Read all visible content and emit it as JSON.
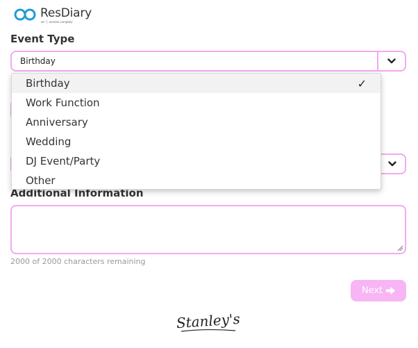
{
  "brand": {
    "name": "ResDiary",
    "tagline": "an ⓘ access company",
    "logo_icon": "infinity-loop-logo",
    "accent_color": "#f2a8f0",
    "logo_blue": "#1f9bd8"
  },
  "form": {
    "event_type_label": "Event Type",
    "event_type_value": "Birthday",
    "additional_info_label": "Additional Information",
    "additional_info_value": "",
    "chars_remaining_text": "2000 of 2000 characters remaining",
    "next_label": "Next",
    "next_icon": "arrow-right-icon"
  },
  "dropdown": {
    "options": [
      {
        "label": "Birthday",
        "selected": true
      },
      {
        "label": "Work Function",
        "selected": false
      },
      {
        "label": "Anniversary",
        "selected": false
      },
      {
        "label": "Wedding",
        "selected": false
      },
      {
        "label": "DJ Event/Party",
        "selected": false
      },
      {
        "label": "Other",
        "selected": false
      }
    ],
    "check_mark": "✓"
  },
  "venue": {
    "logo_text": "Stanley's"
  }
}
